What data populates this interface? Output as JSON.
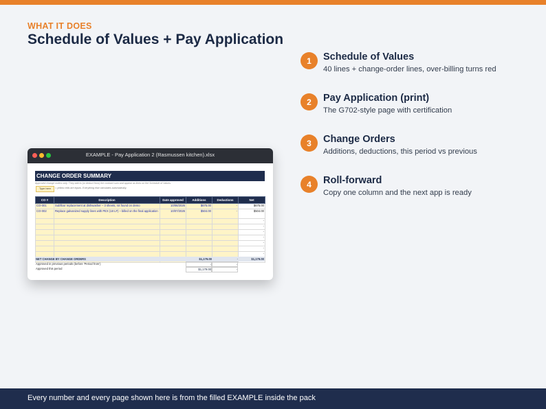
{
  "header": {
    "eyebrow": "WHAT IT DOES",
    "title": "Schedule of Values + Pay Application"
  },
  "features": [
    {
      "num": "1",
      "title": "Schedule of Values",
      "desc": "40 lines + change-order lines, over-billing turns red"
    },
    {
      "num": "2",
      "title": "Pay Application (print)",
      "desc": "The G702-style page with certification"
    },
    {
      "num": "3",
      "title": "Change Orders",
      "desc": "Additions, deductions, this period vs previous"
    },
    {
      "num": "4",
      "title": "Roll-forward",
      "desc": "Copy one column and the next app is ready"
    }
  ],
  "window": {
    "title": "EXAMPLE - Pay Application 2 (Rasmussen kitchen).xlsx",
    "sheet": {
      "heading": "CHANGE ORDER SUMMARY",
      "note": "Approved change orders only. They add to (or deduct from) the contract sum and appear as lines on the Schedule of Values.",
      "type_here": "Type here",
      "legend": "= yellow cells are inputs. Everything else calculates automatically.",
      "columns": [
        "CO #",
        "Description",
        "Date approved",
        "Additions",
        "Deductions",
        "Net"
      ],
      "rows": [
        {
          "co": "CO-001",
          "desc": "Subfloor replacement at dishwasher – 3 sheets, rot found on demo",
          "date": "10/06/2026",
          "add": "$675.00",
          "ded": "-",
          "net": "$675.00"
        },
        {
          "co": "CO-002",
          "desc": "Replace galvanized supply lines with PEX (18 LF) – billed on the final application",
          "date": "10/07/2026",
          "add": "$504.00",
          "ded": "-",
          "net": "$504.00"
        }
      ],
      "blank_net": "-",
      "totals": {
        "net_label": "NET CHANGE BY CHANGE ORDERS",
        "net_add": "$1,179.00",
        "net_ded": "-",
        "net_net": "$1,179.00",
        "prev_label": "Approved in previous periods (before 'Period from')",
        "prev_add": "-",
        "prev_ded": "-",
        "this_label": "Approved this period",
        "this_add": "$1,179.00",
        "this_ded": "-"
      }
    }
  },
  "footer": {
    "text": "Every number and every page shown here is from the filled EXAMPLE inside the pack"
  },
  "colors": {
    "accent": "#e8812a",
    "navy": "#1f2d4d",
    "input_yellow": "#fff4c7"
  }
}
